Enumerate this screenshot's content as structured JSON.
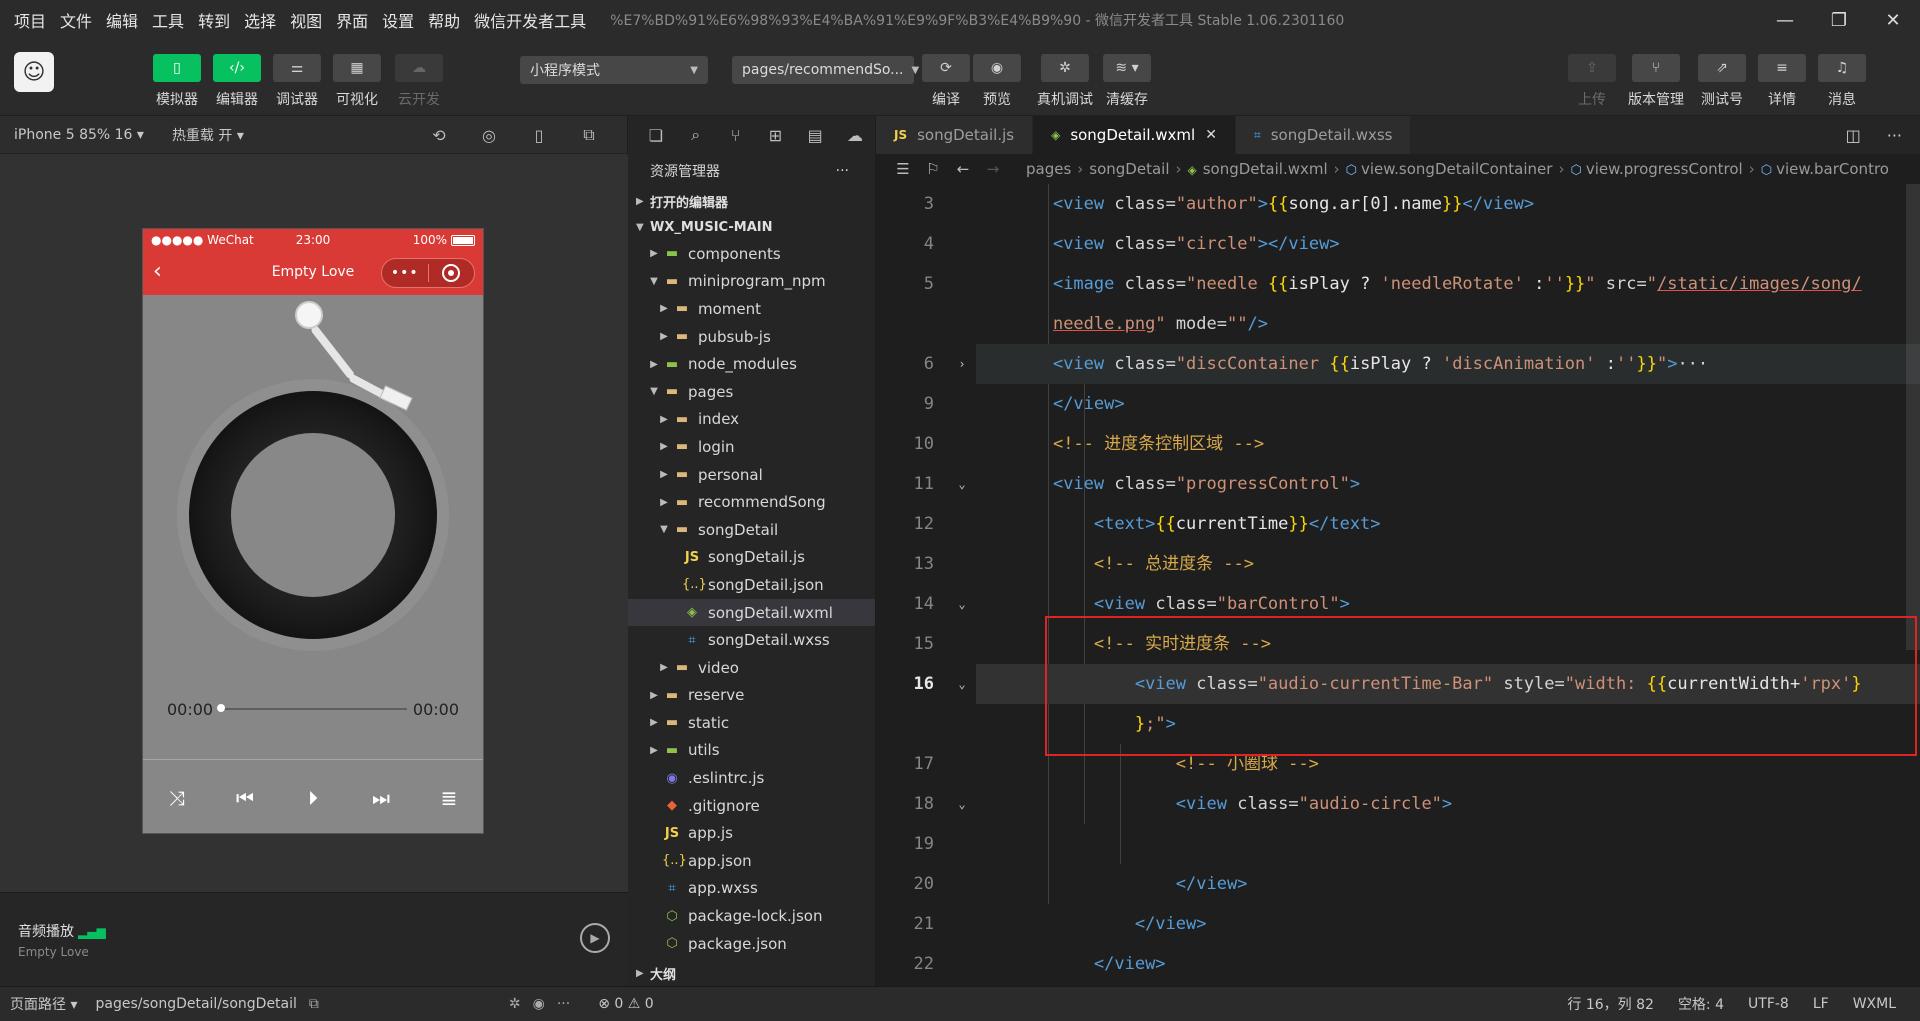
{
  "menu": {
    "items": [
      "项目",
      "文件",
      "编辑",
      "工具",
      "转到",
      "选择",
      "视图",
      "界面",
      "设置",
      "帮助",
      "微信开发者工具"
    ],
    "window_title": "%E7%BD%91%E6%98%93%E4%BA%91%E9%9F%B3%E4%B9%90 - 微信开发者工具 Stable 1.06.2301160"
  },
  "toolbar": {
    "simulator": "模拟器",
    "editor": "编辑器",
    "debugger": "调试器",
    "visual": "可视化",
    "cloud": "云开发",
    "mode_select": "小程序模式",
    "page_select": "pages/recommendSo...",
    "compile": "编译",
    "preview": "预览",
    "remote_debug": "真机调试",
    "clear_cache": "清缓存",
    "upload": "上传",
    "version": "版本管理",
    "test_id": "测试号",
    "details": "详情",
    "messages": "消息"
  },
  "simulator": {
    "device": "iPhone 5 85% 16",
    "hot_reload": "热重载 开",
    "status_left": "●●●●● WeChat",
    "status_time": "23:00",
    "status_battery": "100%",
    "nav_title": "Empty Love",
    "current_time": "00:00",
    "total_time": "00:00",
    "progress_fraction": 0,
    "audio_title": "音频播放",
    "audio_song": "Empty Love"
  },
  "explorer": {
    "title": "资源管理器",
    "open_editors": "打开的编辑器",
    "project": "WX_MUSIC-MAIN",
    "outline": "大纲",
    "items": [
      {
        "name": "components",
        "depth": 1,
        "type": "folder-green",
        "caret": "right"
      },
      {
        "name": "miniprogram_npm",
        "depth": 1,
        "type": "folder",
        "caret": "down"
      },
      {
        "name": "moment",
        "depth": 2,
        "type": "folder",
        "caret": "right"
      },
      {
        "name": "pubsub-js",
        "depth": 2,
        "type": "folder",
        "caret": "right"
      },
      {
        "name": "node_modules",
        "depth": 1,
        "type": "folder-green",
        "caret": "right"
      },
      {
        "name": "pages",
        "depth": 1,
        "type": "folder",
        "caret": "down"
      },
      {
        "name": "index",
        "depth": 2,
        "type": "folder",
        "caret": "right"
      },
      {
        "name": "login",
        "depth": 2,
        "type": "folder",
        "caret": "right"
      },
      {
        "name": "personal",
        "depth": 2,
        "type": "folder",
        "caret": "right"
      },
      {
        "name": "recommendSong",
        "depth": 2,
        "type": "folder",
        "caret": "right"
      },
      {
        "name": "songDetail",
        "depth": 2,
        "type": "folder",
        "caret": "down"
      },
      {
        "name": "songDetail.js",
        "depth": 3,
        "type": "js",
        "caret": ""
      },
      {
        "name": "songDetail.json",
        "depth": 3,
        "type": "json",
        "caret": ""
      },
      {
        "name": "songDetail.wxml",
        "depth": 3,
        "type": "wxml",
        "caret": "",
        "selected": true
      },
      {
        "name": "songDetail.wxss",
        "depth": 3,
        "type": "css",
        "caret": ""
      },
      {
        "name": "video",
        "depth": 2,
        "type": "folder",
        "caret": "right"
      },
      {
        "name": "reserve",
        "depth": 1,
        "type": "folder",
        "caret": "right"
      },
      {
        "name": "static",
        "depth": 1,
        "type": "folder",
        "caret": "right"
      },
      {
        "name": "utils",
        "depth": 1,
        "type": "folder-green",
        "caret": "right"
      },
      {
        "name": ".eslintrc.js",
        "depth": 1,
        "type": "eslint",
        "caret": ""
      },
      {
        "name": ".gitignore",
        "depth": 1,
        "type": "git",
        "caret": ""
      },
      {
        "name": "app.js",
        "depth": 1,
        "type": "js",
        "caret": ""
      },
      {
        "name": "app.json",
        "depth": 1,
        "type": "json",
        "caret": ""
      },
      {
        "name": "app.wxss",
        "depth": 1,
        "type": "css",
        "caret": ""
      },
      {
        "name": "package-lock.json",
        "depth": 1,
        "type": "npm",
        "caret": ""
      },
      {
        "name": "package.json",
        "depth": 1,
        "type": "npm",
        "caret": ""
      }
    ]
  },
  "editor": {
    "tabs": [
      {
        "name": "songDetail.js",
        "type": "js",
        "active": false
      },
      {
        "name": "songDetail.wxml",
        "type": "wxml",
        "active": true
      },
      {
        "name": "songDetail.wxss",
        "type": "css",
        "active": false
      }
    ],
    "breadcrumb": [
      "pages",
      "songDetail",
      "songDetail.wxml",
      "view.songDetailContainer",
      "view.progressControl",
      "view.barContro"
    ],
    "line_numbers": [
      "3",
      "4",
      "5",
      "",
      "6",
      "9",
      "10",
      "11",
      "12",
      "13",
      "14",
      "15",
      "16",
      "",
      "17",
      "18",
      "19",
      "20",
      "21",
      "22"
    ],
    "current_line": "16"
  },
  "status": {
    "page_path_label": "页面路径",
    "page_path": "pages/songDetail/songDetail",
    "errors": "0",
    "warnings": "0",
    "cursor": "行 16，列 82",
    "indent": "空格: 4",
    "encoding": "UTF-8",
    "eol": "LF",
    "language": "WXML"
  },
  "colors": {
    "wechat_green": "#07c160",
    "nav_red": "#d93a35",
    "highlight_box": "#e02424"
  }
}
